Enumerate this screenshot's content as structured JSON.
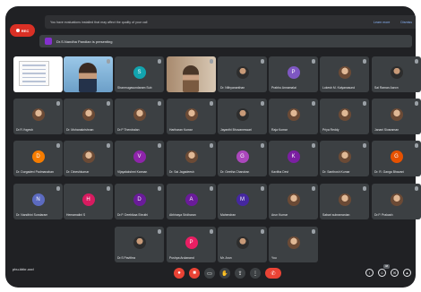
{
  "banner": {
    "message": "You have evaluations installed that may affect the quality of your call",
    "learn_more": "Learn more",
    "dismiss": "Dismiss"
  },
  "recording": {
    "label": "REC"
  },
  "presenting": {
    "text": "Dr.S.Nandha Pandian is presenting"
  },
  "meeting": {
    "code": "pbu-kbkr-ood"
  },
  "participant_count": "48",
  "participants": [
    {
      "name": "",
      "type": "slide"
    },
    {
      "name": "",
      "type": "cam1"
    },
    {
      "name": "Shanmugasundaram Sub",
      "initial": "S",
      "color": "#12a4af",
      "type": "letter"
    },
    {
      "name": "",
      "type": "cam2"
    },
    {
      "name": "Dr. Nithyananthan",
      "type": "photo2"
    },
    {
      "name": "Prabhu Annamalai",
      "initial": "P",
      "color": "#7e57c2",
      "type": "letter"
    },
    {
      "name": "Lokesh M. Kalyanasund",
      "type": "photo"
    },
    {
      "name": "Sai Raman Aaron",
      "type": "photo2"
    },
    {
      "name": "Dr.R.Yogesh",
      "type": "photo"
    },
    {
      "name": "Dr. Mohanakrishnan",
      "type": "photo"
    },
    {
      "name": "Dr.P Thendralan",
      "type": "photo"
    },
    {
      "name": "Hariharan Kumar",
      "type": "photo"
    },
    {
      "name": "Jayanthi Bhuvaneswari",
      "type": "photo2"
    },
    {
      "name": "Raja Kumar",
      "type": "photo"
    },
    {
      "name": "Priya Reddy",
      "type": "photo"
    },
    {
      "name": "Janani Sivaraman",
      "type": "photo"
    },
    {
      "name": "Dr. Durgadevi Padmanaban",
      "initial": "D",
      "color": "#f57c00",
      "type": "letter"
    },
    {
      "name": "Dr. Dineshkumar",
      "type": "photo"
    },
    {
      "name": "Vijayalakshmi Kannan",
      "initial": "V",
      "color": "#8e24aa",
      "type": "letter"
    },
    {
      "name": "Dr. Sai Jagadeesh",
      "type": "photo"
    },
    {
      "name": "Dr. Geetha Chandran",
      "initial": "G",
      "color": "#ab47bc",
      "type": "letter"
    },
    {
      "name": "Kavitha Devi",
      "initial": "K",
      "color": "#7b1fa2",
      "type": "letter"
    },
    {
      "name": "Dr. Santhosh Kumar",
      "type": "photo"
    },
    {
      "name": "Dr. R. Ganga Bhavani",
      "initial": "G",
      "color": "#e65100",
      "type": "letter"
    },
    {
      "name": "Dr. Nandhini Sundaram",
      "initial": "N",
      "color": "#5c6bc0",
      "type": "letter"
    },
    {
      "name": "Hemamalini S",
      "initial": "H",
      "color": "#d81b60",
      "type": "letter"
    },
    {
      "name": "Dr.P. Deebikaa Shruthi",
      "initial": "D",
      "color": "#6a1b9a",
      "type": "letter"
    },
    {
      "name": "Abhinaya Sridharan",
      "initial": "A",
      "color": "#6a1b9a",
      "type": "letter"
    },
    {
      "name": "Mahendran",
      "initial": "M",
      "color": "#4527a0",
      "type": "letter"
    },
    {
      "name": "Arun Kumar",
      "type": "photo"
    },
    {
      "name": "Sabari subramanian",
      "type": "photo"
    },
    {
      "name": "Dr.P. Prakash",
      "type": "photo"
    },
    {
      "name": "Dr.S Pavithra",
      "type": "photo2"
    },
    {
      "name": "Pushpa Arulanand",
      "initial": "P",
      "color": "#e91e63",
      "type": "letter"
    },
    {
      "name": "Mr. Arun",
      "type": "photo2"
    },
    {
      "name": "You",
      "type": "photo"
    }
  ],
  "colors": {
    "background": "#202124",
    "tile": "#3c4043",
    "end_call": "#ea4335"
  }
}
